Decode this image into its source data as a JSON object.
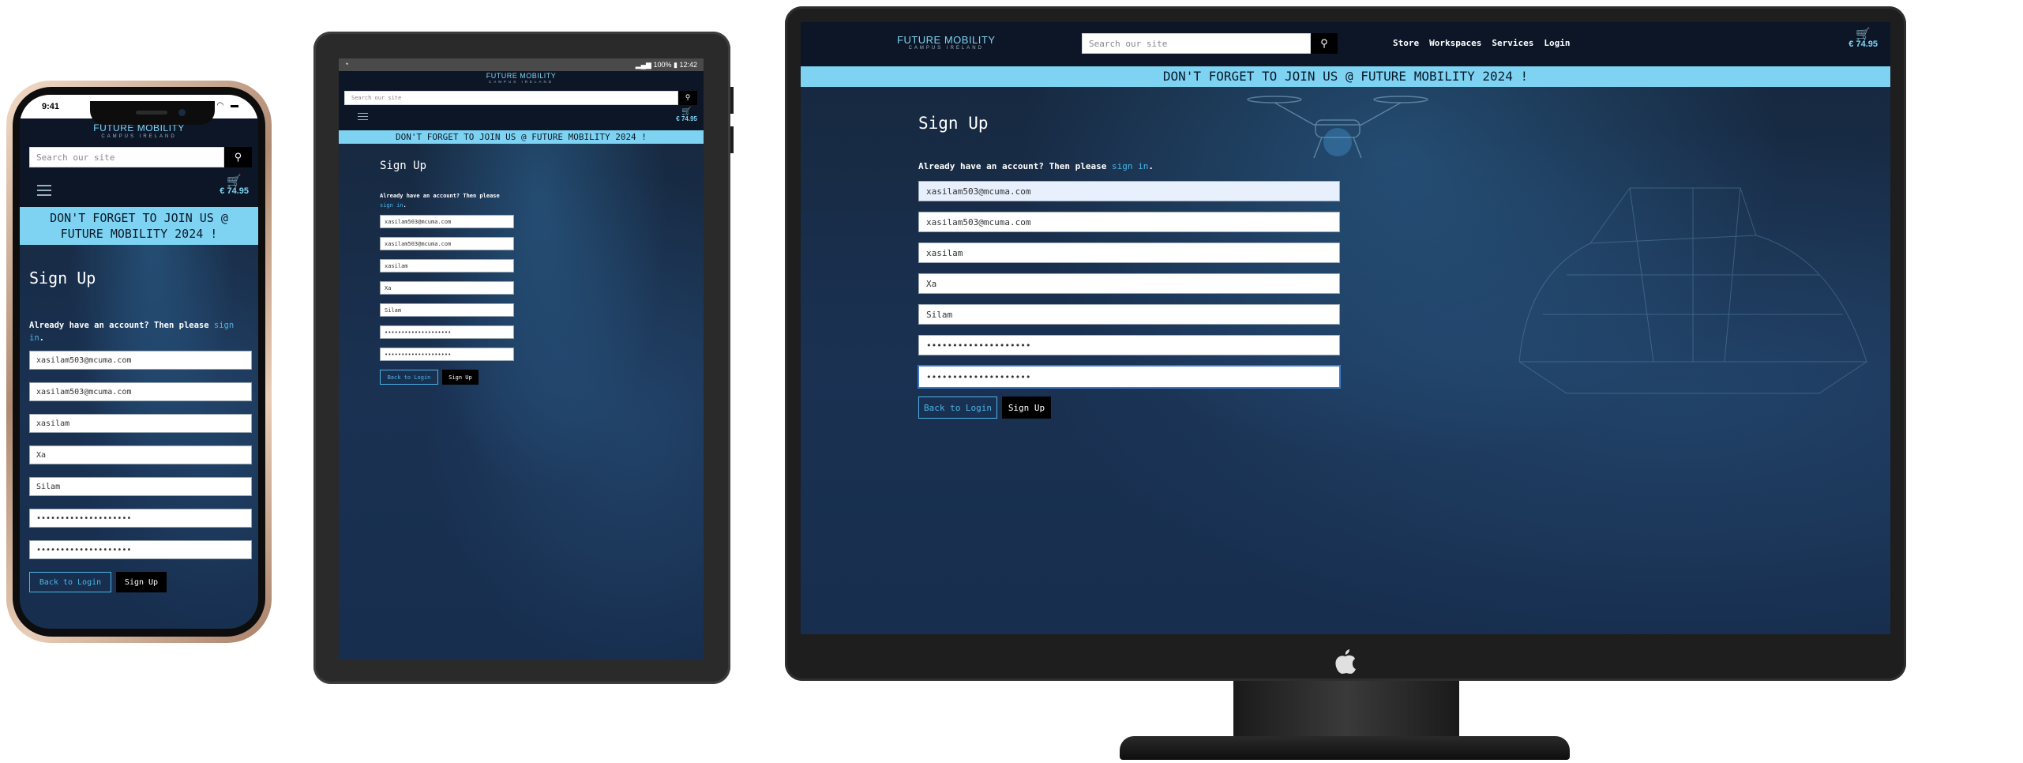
{
  "brand": {
    "name": "FUTURE MOBILITY",
    "tagline": "CAMPUS IRELAND"
  },
  "search": {
    "placeholder": "Search our site"
  },
  "nav": {
    "items": [
      "Store",
      "Workspaces",
      "Services",
      "Login"
    ]
  },
  "cart": {
    "total": "€ 74.95"
  },
  "banner": {
    "text": "DON'T FORGET TO JOIN US @ FUTURE MOBILITY 2024 !"
  },
  "signup": {
    "title": "Sign Up",
    "lead_text": "Already have an account? Then please",
    "signin_link": "sign in",
    "lead_end": ".",
    "fields": {
      "email": "xasilam503@mcuma.com",
      "email_confirm": "xasilam503@mcuma.com",
      "username": "xasilam",
      "first_name": "Xa",
      "last_name": "Silam",
      "password": "••••••••••••••••••••",
      "password_confirm": "••••••••••••••••••••"
    },
    "back_label": "Back to Login",
    "submit_label": "Sign Up"
  },
  "phone_status": {
    "time": "9:41"
  },
  "tablet_status": {
    "battery": "100%",
    "time": "12:42"
  },
  "colors": {
    "accent": "#7fd3f2",
    "link": "#4bb5e6",
    "page_bg": "#1a3152",
    "header_bg": "#0d1626"
  },
  "icons": [
    "search-icon",
    "cart-icon",
    "menu-icon",
    "apple-logo-icon"
  ]
}
